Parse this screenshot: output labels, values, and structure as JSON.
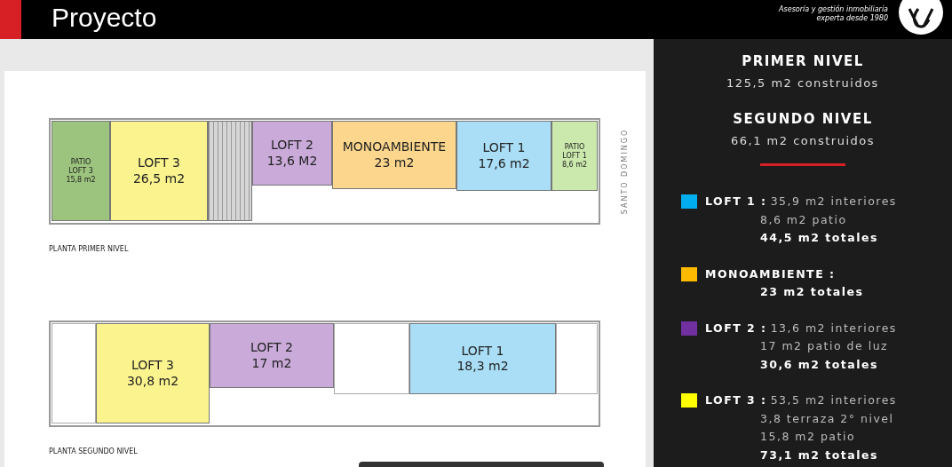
{
  "header": {
    "title": "Proyecto",
    "tagline": [
      "Asesoría y gestión inmobiliaria",
      "experta desde 1980"
    ]
  },
  "plans": [
    {
      "caption": "PLANTA PRIMER NIVEL",
      "street": "SANTO DOMINGO",
      "rooms": [
        {
          "kind": "patio",
          "color": "#9cc47e",
          "lines": [
            "PATIO",
            "LOFT 3",
            "15,8 m2"
          ]
        },
        {
          "kind": "unit",
          "color": "#fbf48e",
          "lines": [
            "LOFT 3",
            "26,5 m2"
          ]
        },
        {
          "kind": "stair",
          "color": "#d6d6d6"
        },
        {
          "kind": "unit",
          "color": "#c9aad9",
          "lines": [
            "LOFT 2",
            "13,6 M2"
          ]
        },
        {
          "kind": "unit",
          "color": "#fbd68c",
          "lines": [
            "MONOAMBIENTE",
            "23 m2"
          ]
        },
        {
          "kind": "unit",
          "color": "#a9def6",
          "lines": [
            "LOFT 1",
            "17,6 m2"
          ]
        },
        {
          "kind": "patio",
          "color": "#cbe9ad",
          "lines": [
            "PATIO",
            "LOFT 1",
            "8,6 m2"
          ]
        }
      ]
    },
    {
      "caption": "PLANTA SEGUNDO NIVEL",
      "rooms": [
        {
          "kind": "empty",
          "color": "#ffffff"
        },
        {
          "kind": "unit",
          "color": "#fbf48e",
          "lines": [
            "LOFT 3",
            "30,8 m2"
          ]
        },
        {
          "kind": "unit",
          "color": "#c9aad9",
          "lines": [
            "LOFT 2",
            "17 m2"
          ]
        },
        {
          "kind": "empty",
          "color": "#ffffff"
        },
        {
          "kind": "unit",
          "color": "#a9def6",
          "lines": [
            "LOFT 1",
            "18,3 m2"
          ]
        },
        {
          "kind": "empty",
          "color": "#ffffff"
        }
      ]
    }
  ],
  "summary": {
    "levels": [
      {
        "title": "PRIMER NIVEL",
        "built": "125,5 m2 construidos"
      },
      {
        "title": "SEGUNDO NIVEL",
        "built": "66,1 m2 construidos"
      }
    ],
    "units": [
      {
        "name": "LOFT 1 :",
        "color": "#00aeef",
        "details": [
          "35,9 m2 interiores",
          "8,6 m2 patio"
        ],
        "total": "44,5 m2 totales"
      },
      {
        "name": "MONOAMBIENTE :",
        "color": "#ffba00",
        "total": "23 m2 totales"
      },
      {
        "name": "LOFT 2 :",
        "color": "#7030a0",
        "details": [
          "13,6 m2 interiores",
          "17 m2 patio de luz"
        ],
        "total": "30,6 m2 totales"
      },
      {
        "name": "LOFT 3 :",
        "color": "#ffff00",
        "details": [
          "53,5 m2 interiores",
          "3,8 terraza 2° nivel",
          "15,8 m2 patio"
        ],
        "total": "73,1 m2 totales"
      }
    ]
  }
}
